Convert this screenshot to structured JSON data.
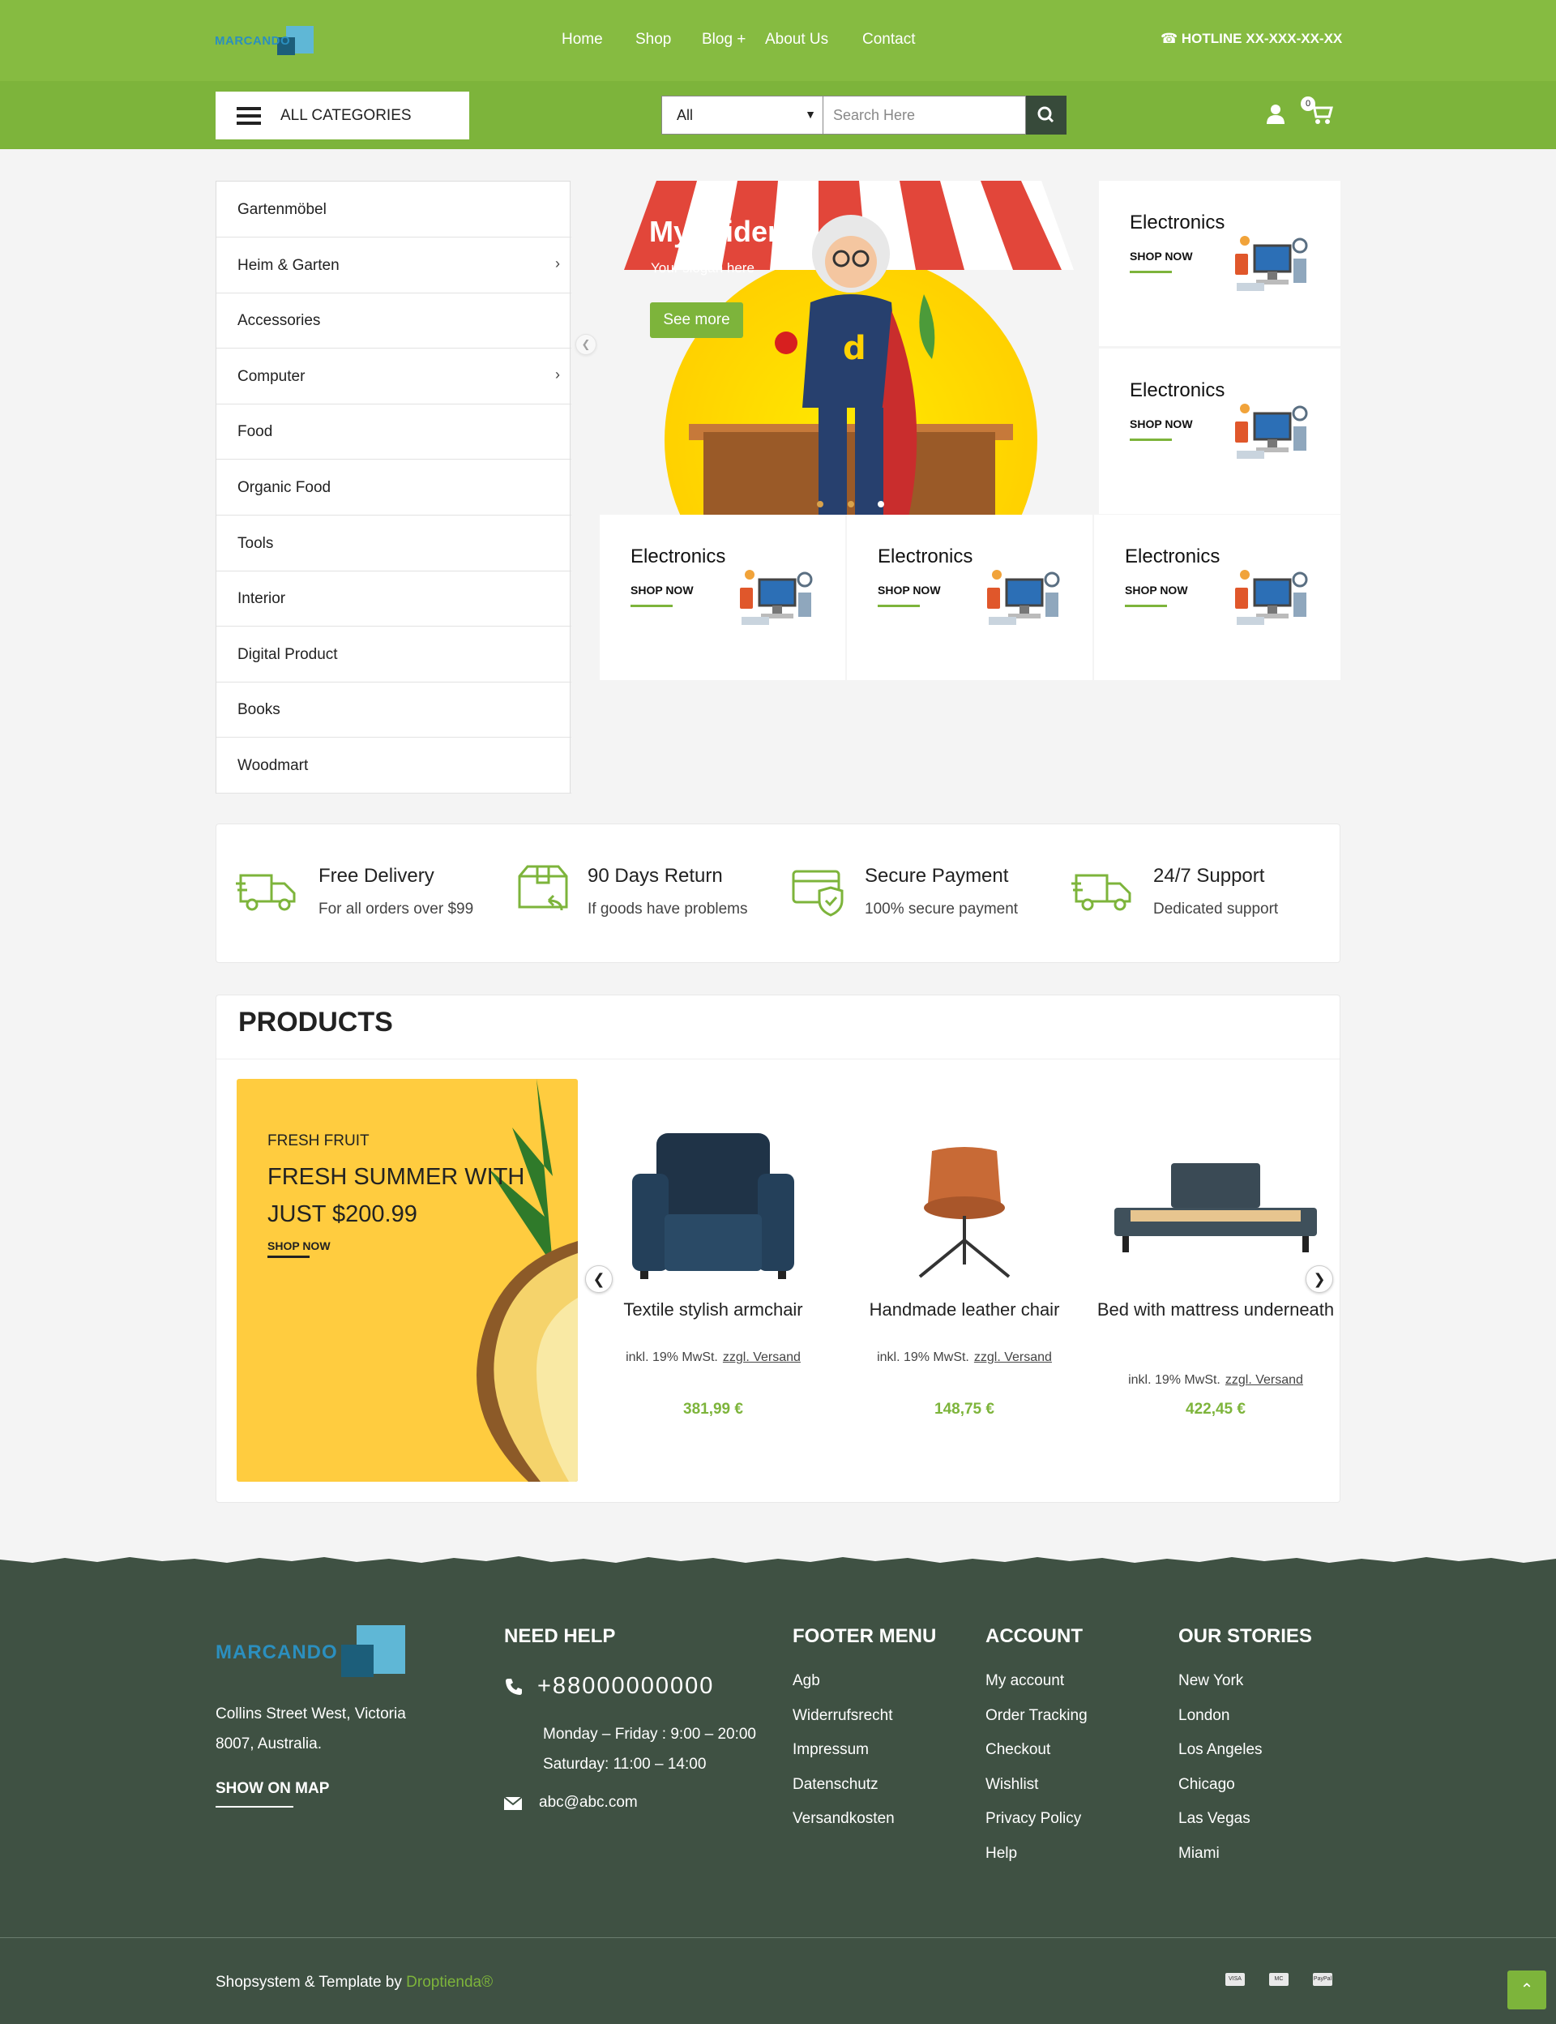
{
  "header": {
    "logo_text": "MARCANDO",
    "nav": [
      "Home",
      "Shop",
      "Blog +",
      "About Us",
      "Contact"
    ],
    "hotline": "☎ HOTLINE XX-XXX-XX-XX"
  },
  "searchbar": {
    "all_categories": "ALL CATEGORIES",
    "category_select": "All",
    "placeholder": "Search Here",
    "cart_count": "0"
  },
  "sidebar": {
    "items": [
      {
        "label": "Gartenmöbel",
        "sub": false
      },
      {
        "label": "Heim & Garten",
        "sub": true
      },
      {
        "label": "Accessories",
        "sub": false
      },
      {
        "label": "Computer",
        "sub": true
      },
      {
        "label": "Food",
        "sub": false
      },
      {
        "label": "Organic Food",
        "sub": false
      },
      {
        "label": "Tools",
        "sub": false
      },
      {
        "label": "Interior",
        "sub": false
      },
      {
        "label": "Digital Product",
        "sub": false
      },
      {
        "label": "Books",
        "sub": false
      },
      {
        "label": "Woodmart",
        "sub": false
      }
    ]
  },
  "slider": {
    "title": "My Slider",
    "slogan": "Your slogan here",
    "button": "See more"
  },
  "promos": {
    "title": "Electronics",
    "cta": "SHOP NOW"
  },
  "features": [
    {
      "title": "Free Delivery",
      "desc": "For all orders over $99",
      "icon": "truck-icon"
    },
    {
      "title": "90 Days Return",
      "desc": "If goods have problems",
      "icon": "return-box-icon"
    },
    {
      "title": "Secure Payment",
      "desc": "100% secure payment",
      "icon": "secure-card-icon"
    },
    {
      "title": "24/7 Support",
      "desc": "Dedicated support",
      "icon": "truck-icon"
    }
  ],
  "products": {
    "heading": "PRODUCTS",
    "banner": {
      "kicker": "FRESH FRUIT",
      "headline": "FRESH SUMMER WITH JUST $200.99",
      "cta": "SHOP NOW"
    },
    "items": [
      {
        "name": "Textile stylish armchair",
        "tax": "inkl. 19% MwSt.",
        "shipping": "zzgl. Versand",
        "price": "381,99 €"
      },
      {
        "name": "Handmade leather chair",
        "tax": "inkl. 19% MwSt.",
        "shipping": "zzgl. Versand",
        "price": "148,75 €"
      },
      {
        "name": "Bed with mattress underneath",
        "tax": "inkl. 19% MwSt.",
        "shipping": "zzgl. Versand",
        "price": "422,45 €"
      }
    ]
  },
  "footer": {
    "logo_text": "MARCANDO",
    "address_line1": "Collins Street West, Victoria",
    "address_line2": "8007, Australia.",
    "show_on_map": "SHOW ON MAP",
    "need_help": {
      "heading": "NEED HELP",
      "phone": "+88000000000",
      "hours1": "Monday – Friday : 9:00 – 20:00",
      "hours2": "Saturday: 11:00 – 14:00",
      "email": "abc@abc.com"
    },
    "footer_menu": {
      "heading": "FOOTER MENU",
      "links": [
        "Agb",
        "Widerrufsrecht",
        "Impressum",
        "Datenschutz",
        "Versandkosten"
      ]
    },
    "account": {
      "heading": "ACCOUNT",
      "links": [
        "My account",
        "Order Tracking",
        "Checkout",
        "Wishlist",
        "Privacy Policy",
        "Help"
      ]
    },
    "stories": {
      "heading": "OUR STORIES",
      "links": [
        "New York",
        "London",
        "Los Angeles",
        "Chicago",
        "Las Vegas",
        "Miami"
      ]
    },
    "copyright_prefix": "Shopsystem & Template by",
    "copyright_brand": "Droptienda®",
    "payments": [
      "VISA",
      "MC",
      "PayPal"
    ]
  },
  "colors": {
    "brand_green": "#86bb41",
    "dark_green": "#3f5143",
    "banner_yellow": "#ffcc3f"
  }
}
